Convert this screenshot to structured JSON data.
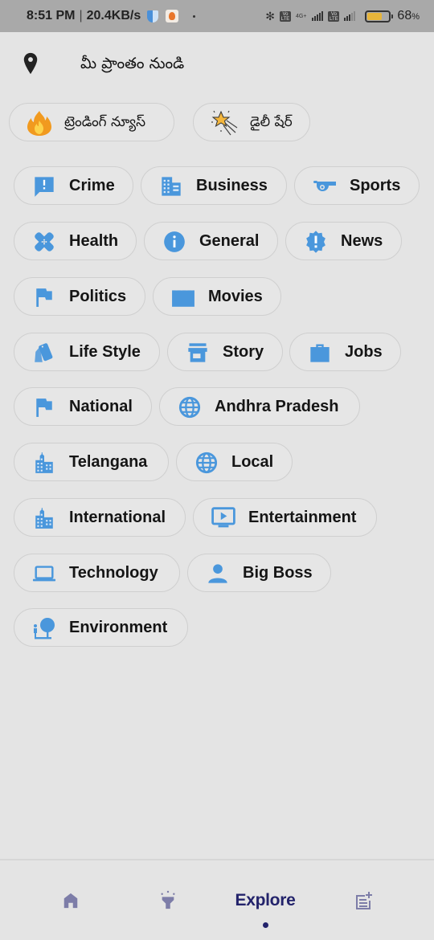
{
  "status_bar": {
    "time": "8:51 PM",
    "separator": "|",
    "network_speed": "20.4KB/s",
    "battery_percent": "68",
    "battery_unit": "%",
    "battery_level": 0.68,
    "sim1_label": "4G+",
    "volte_label": "Vo LTE"
  },
  "location": {
    "icon": "location-pin-icon",
    "label": "మీ ప్రాంతం నుండి"
  },
  "featured": [
    {
      "icon": "fire-icon",
      "label": "ట్రెండింగ్ న్యూస్"
    },
    {
      "icon": "shooting-star-icon",
      "label": "డైలీ షేర్"
    }
  ],
  "categories": [
    {
      "icon": "chat-alert-icon",
      "label": "Crime"
    },
    {
      "icon": "office-building-icon",
      "label": "Business"
    },
    {
      "icon": "whistle-icon",
      "label": "Sports"
    },
    {
      "icon": "bandage-icon",
      "label": "Health"
    },
    {
      "icon": "info-icon",
      "label": "General"
    },
    {
      "icon": "alert-badge-icon",
      "label": "News"
    },
    {
      "icon": "flag-icon",
      "label": "Politics"
    },
    {
      "icon": "clapperboard-icon",
      "label": "Movies"
    },
    {
      "icon": "cards-icon",
      "label": "Life Style"
    },
    {
      "icon": "store-icon",
      "label": "Story"
    },
    {
      "icon": "briefcase-icon",
      "label": "Jobs"
    },
    {
      "icon": "flag-icon",
      "label": "National"
    },
    {
      "icon": "globe-icon",
      "label": "Andhra Pradesh"
    },
    {
      "icon": "city-icon",
      "label": "Telangana"
    },
    {
      "icon": "globe-icon",
      "label": "Local"
    },
    {
      "icon": "city-icon",
      "label": "International"
    },
    {
      "icon": "tv-play-icon",
      "label": "Entertainment"
    },
    {
      "icon": "laptop-icon",
      "label": "Technology"
    },
    {
      "icon": "person-icon",
      "label": "Big Boss"
    },
    {
      "icon": "nature-people-icon",
      "label": "Environment"
    }
  ],
  "bottom_nav": {
    "items": [
      {
        "icon": "home-icon",
        "label": ""
      },
      {
        "icon": "spotlight-icon",
        "label": ""
      },
      {
        "icon": "",
        "label": "Explore",
        "active": true
      },
      {
        "icon": "post-add-icon",
        "label": ""
      }
    ]
  },
  "colors": {
    "accent": "#4a97dc",
    "nav_active": "#23236b",
    "nav_inactive": "#7d7da8"
  }
}
